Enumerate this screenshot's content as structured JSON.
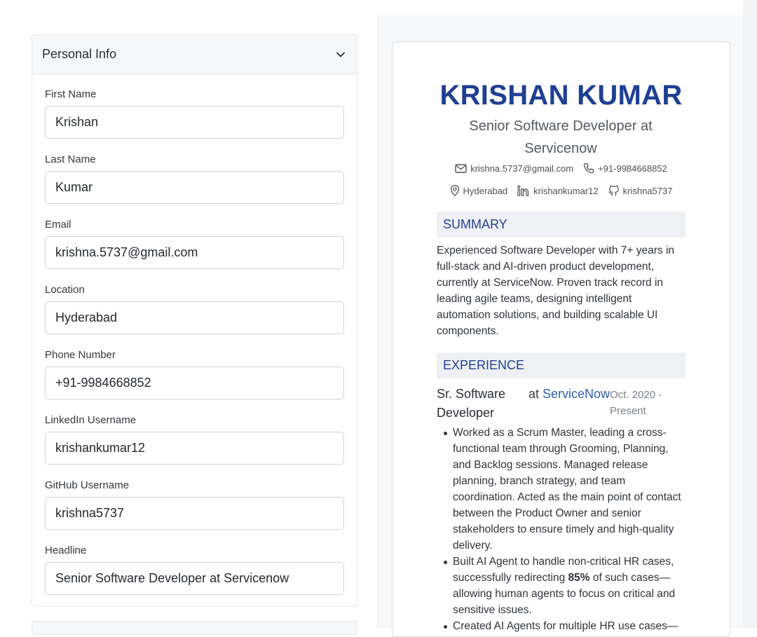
{
  "personal_info": {
    "title": "Personal Info",
    "fields": [
      {
        "label": "First Name",
        "value": "Krishan"
      },
      {
        "label": "Last Name",
        "value": "Kumar"
      },
      {
        "label": "Email",
        "value": "krishna.5737@gmail.com"
      },
      {
        "label": "Location",
        "value": "Hyderabad"
      },
      {
        "label": "Phone Number",
        "value": "+91-9984668852"
      },
      {
        "label": "LinkedIn Username",
        "value": "krishankumar12"
      },
      {
        "label": "GitHub Username",
        "value": "krishna5737"
      },
      {
        "label": "Headline",
        "value": "Senior Software Developer at Servicenow"
      }
    ]
  },
  "resume": {
    "name": "KRISHAN KUMAR",
    "headline": "Senior Software Developer at Servicenow",
    "email": "krishna.5737@gmail.com",
    "phone": "+91-9984668852",
    "location": "Hyderabad",
    "linkedin": "krishankumar12",
    "github": "krishna5737",
    "summary_heading": "SUMMARY",
    "summary": "Experienced Software Developer with 7+ years in full-stack and AI-driven product development, currently at ServiceNow. Proven track record in leading agile teams, designing intelligent automation solutions, and building scalable UI components.",
    "experience_heading": "EXPERIENCE",
    "job": {
      "title": "Sr. Software Developer",
      "at": "at",
      "company": "ServiceNow",
      "dates": "Oct. 2020 - Present",
      "bullets": [
        {
          "text": "Worked as a Scrum Master, leading a cross-functional team through Grooming, Planning, and Backlog sessions. Managed release planning, branch strategy, and team coordination. Acted as the main point of contact between the Product Owner and senior stakeholders to ensure timely and high-quality delivery."
        },
        {
          "pre": "Built AI Agent to handle non-critical HR cases, successfully redirecting ",
          "bold": "85%",
          "post": " of such cases—allowing human agents to focus on critical and sensitive issues."
        },
        {
          "text": "Created AI Agents for multiple HR use cases—"
        }
      ]
    }
  },
  "colors": {
    "name_blue": "#1f3f93",
    "company_link": "#2f5fb3",
    "section_bg": "#eef0f3"
  },
  "icons": [
    "chevron-down-icon",
    "mail-icon",
    "phone-icon",
    "location-pin-icon",
    "linkedin-icon",
    "github-icon"
  ]
}
